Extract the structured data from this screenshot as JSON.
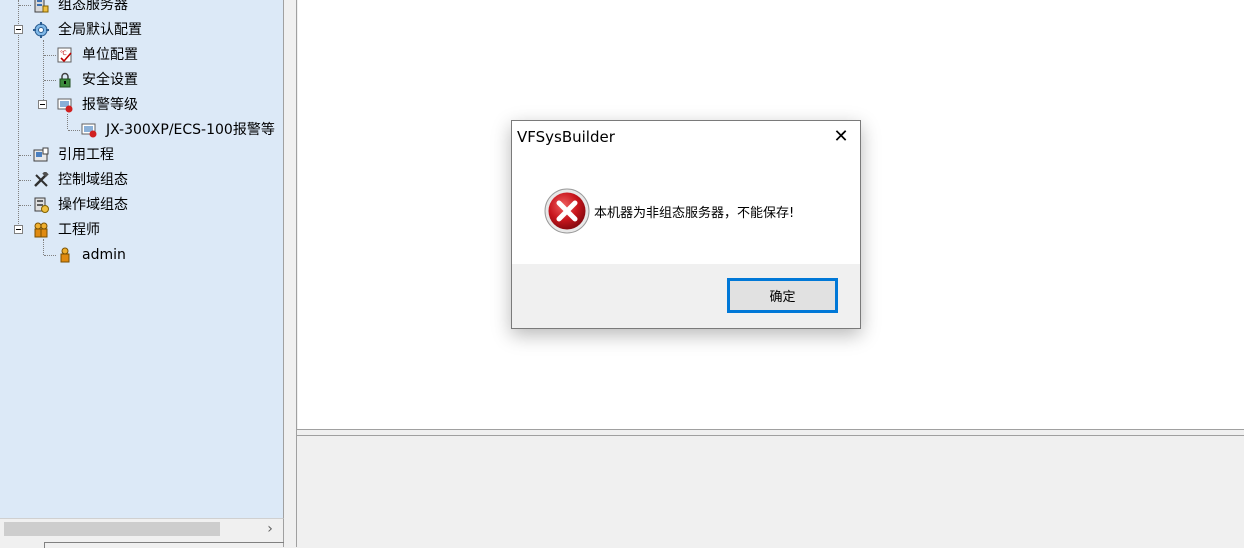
{
  "tree": {
    "items": [
      {
        "label": "组态服务器",
        "icon": "server-icon"
      },
      {
        "label": "全局默认配置",
        "icon": "gear-icon"
      },
      {
        "label": "单位配置",
        "icon": "unit-config-icon"
      },
      {
        "label": "安全设置",
        "icon": "lock-icon"
      },
      {
        "label": "报警等级",
        "icon": "alarm-level-icon"
      },
      {
        "label": "JX-300XP/ECS-100报警等",
        "icon": "alarm-item-icon"
      },
      {
        "label": "引用工程",
        "icon": "reference-project-icon"
      },
      {
        "label": "控制域组态",
        "icon": "tools-icon"
      },
      {
        "label": "操作域组态",
        "icon": "operation-domain-icon"
      },
      {
        "label": "工程师",
        "icon": "engineers-icon"
      },
      {
        "label": "admin",
        "icon": "user-icon"
      }
    ]
  },
  "scrollbar": {
    "right_arrow": "›"
  },
  "dialog": {
    "title": "VFSysBuilder",
    "close_glyph": "✕",
    "message": "本机器为非组态服务器，不能保存!",
    "ok_label": "确定",
    "icon": "error-icon"
  },
  "colors": {
    "tree_bg": "#dce9f7",
    "error_red": "#c8161d",
    "focus_blue": "#0078d7"
  }
}
